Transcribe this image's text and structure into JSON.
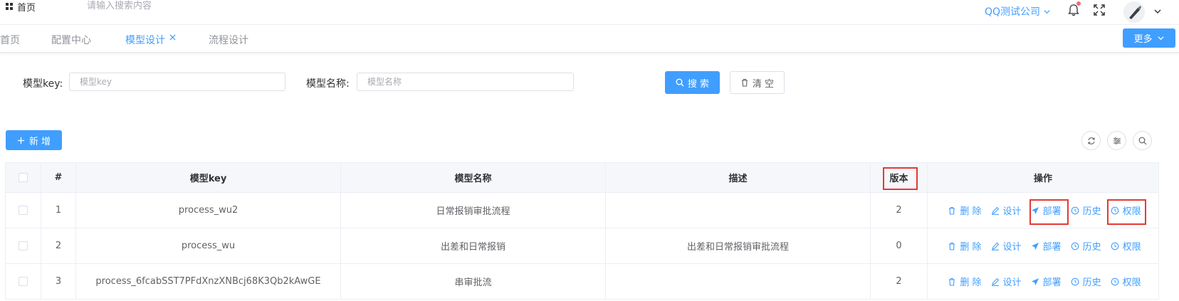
{
  "header": {
    "home_label": "首页",
    "search_placeholder": "请输入搜索内容",
    "company": "QQ测试公司",
    "icons": [
      "grid-icon",
      "bell-icon",
      "fullscreen-icon",
      "avatar",
      "chevron-down-icon"
    ],
    "notification_dot_color": "#f56c6c"
  },
  "tabs": [
    {
      "label": "首页"
    },
    {
      "label": "配置中心"
    },
    {
      "label": "模型设计",
      "active": true
    },
    {
      "label": "流程设计"
    }
  ],
  "more_label": "更多",
  "filters": {
    "key_label": "模型key:",
    "key_placeholder": "模型key",
    "name_label": "模型名称:",
    "name_placeholder": "模型名称",
    "search_label": "搜 索",
    "clear_label": "清 空"
  },
  "add_label": "新 增",
  "toolbar_icons": [
    "refresh-icon",
    "column-settings-icon",
    "search-toggle-icon"
  ],
  "table": {
    "headers": {
      "index": "#",
      "key": "模型key",
      "name": "模型名称",
      "desc": "描述",
      "version": "版本",
      "ops": "操作"
    },
    "op_labels": {
      "delete": "删 除",
      "design": "设计",
      "deploy": "部署",
      "history": "历史",
      "permission": "权限"
    },
    "rows": [
      {
        "index": "1",
        "key": "process_wu2",
        "name": "日常报销审批流程",
        "desc": "",
        "version": "2"
      },
      {
        "index": "2",
        "key": "process_wu",
        "name": "出差和日常报销",
        "desc": "出差和日常报销审批流程",
        "version": "0"
      },
      {
        "index": "3",
        "key": "process_6fcabSST7PFdXnzXNBcj68K3Qb2kAwGE",
        "name": "串审批流",
        "desc": "",
        "version": "2"
      }
    ]
  },
  "colors": {
    "accent": "#409eff",
    "highlight": "#e53935",
    "border": "#ebeef5",
    "header_bg": "#f5f7fa"
  }
}
